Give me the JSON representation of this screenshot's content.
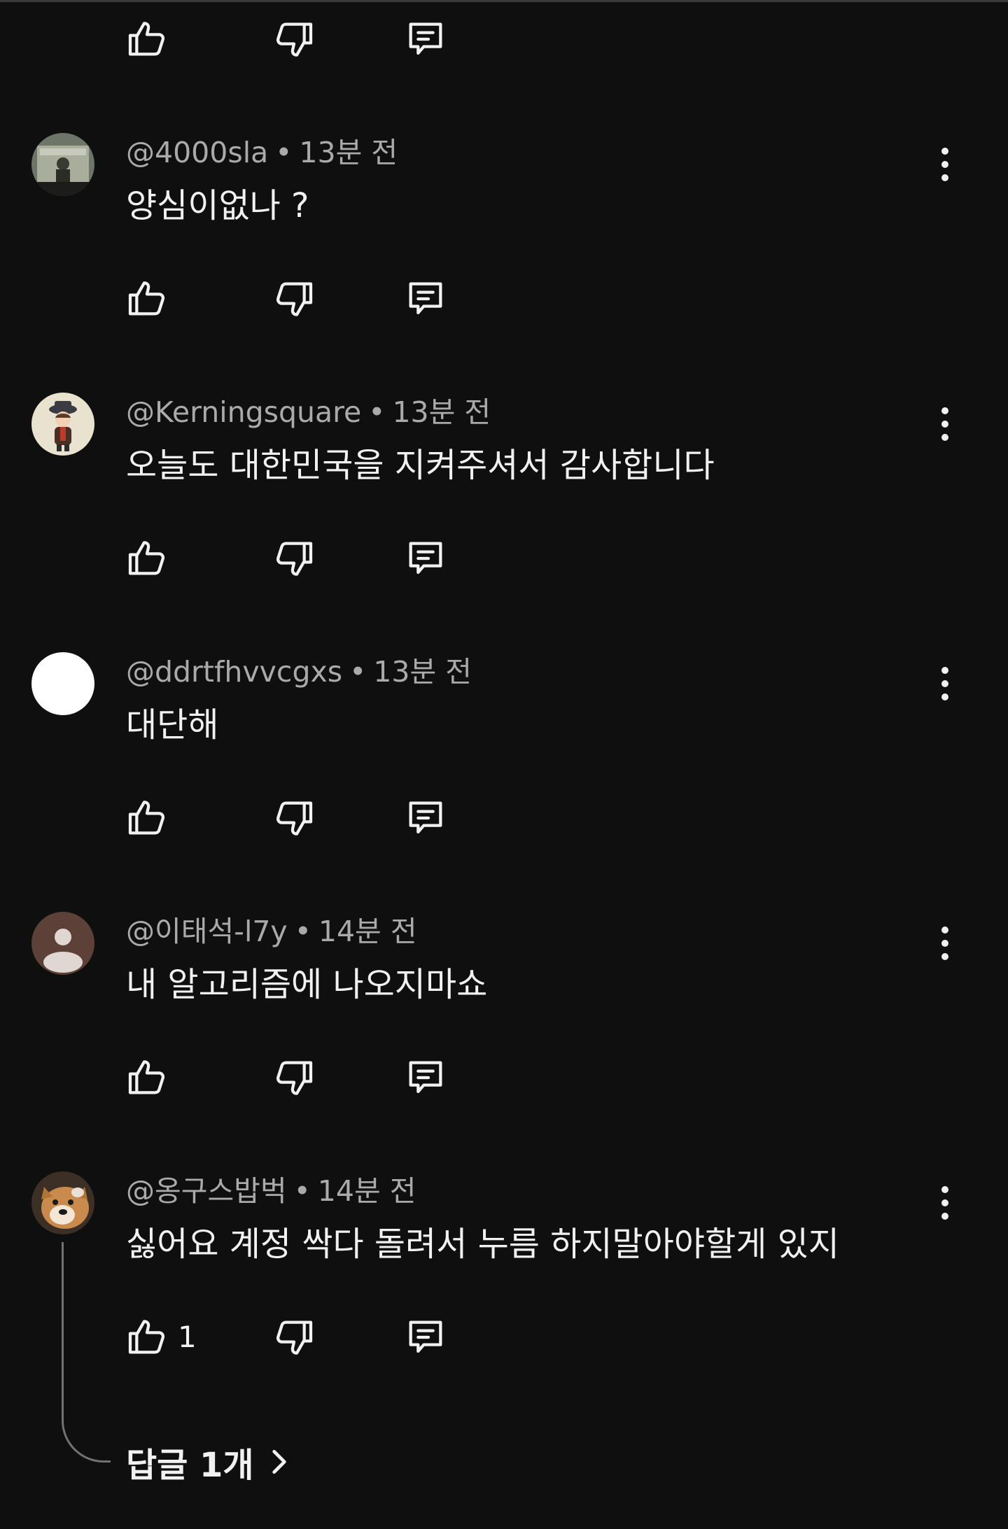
{
  "comments": [
    {
      "handle": "@4000sla",
      "time": "13분 전",
      "text": "양심이없나 ?",
      "avatar": "photo-avatar-portrait",
      "likes": ""
    },
    {
      "handle": "@Kerningsquare",
      "time": "13분 전",
      "text": "오늘도 대한민국을 지켜주셔서 감사합니다",
      "avatar": "cartoon-character-avatar",
      "likes": ""
    },
    {
      "handle": "@ddrtfhvvcgxs",
      "time": "13분 전",
      "text": "대단해",
      "avatar": "blank-white-avatar",
      "likes": ""
    },
    {
      "handle": "@이태석-l7y",
      "time": "14분 전",
      "text": "내 알고리즘에 나오지마쇼",
      "avatar": "default-person-avatar",
      "likes": ""
    },
    {
      "handle": "@옹구스밥벅",
      "time": "14분 전",
      "text": "싫어요 계정 싹다 돌려서 누름 하지말아야할게 있지",
      "avatar": "dog-photo-avatar",
      "likes": "1"
    }
  ],
  "separator": "•",
  "replies_link": {
    "label": "답글 1개"
  },
  "icons": {
    "like": "thumbs-up-icon",
    "dislike": "thumbs-down-icon",
    "reply": "comment-reply-icon",
    "more": "more-vertical-icon",
    "chevron": "chevron-right-icon"
  },
  "colors": {
    "background": "#0f0f0f",
    "primary_text": "#f1f1f1",
    "secondary_text": "#aaaaaa",
    "thread_line": "#717171"
  }
}
